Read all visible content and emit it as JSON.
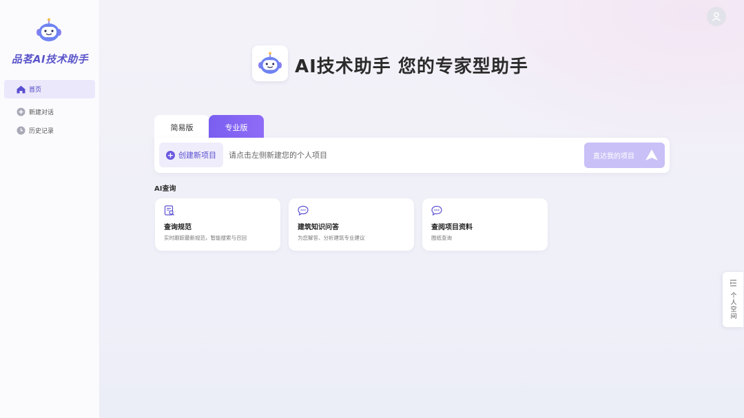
{
  "brand": {
    "title": "品茗AI技术助手"
  },
  "nav": {
    "items": [
      {
        "label": "首页",
        "icon": "home-icon",
        "active": true
      },
      {
        "label": "新建对话",
        "icon": "plus-circle-icon",
        "active": false
      },
      {
        "label": "历史记录",
        "icon": "clock-icon",
        "active": false
      }
    ]
  },
  "hero": {
    "title": "AI技术助手 您的专家型助手"
  },
  "tabs": {
    "simple": "简易版",
    "pro": "专业版"
  },
  "project_bar": {
    "create_label": "创建新项目",
    "placeholder": "请点击左侧新建您的个人项目",
    "value": "",
    "goto_label": "直达我的项目"
  },
  "section": {
    "title": "AI查询"
  },
  "cards": [
    {
      "title": "查询规范",
      "desc": "实时跟踪最新规范，智能搜索与召回",
      "icon": "document-search-icon"
    },
    {
      "title": "建筑知识问答",
      "desc": "为您解答、分析建筑专业建议",
      "icon": "chat-bubble-icon"
    },
    {
      "title": "查阅项目资料",
      "desc": "图纸查询",
      "icon": "chat-bubble-icon"
    }
  ],
  "side_tab": {
    "label": "个人空间"
  },
  "colors": {
    "accent": "#7a5ff0",
    "accent_light": "#c9c0f7",
    "brand_text": "#5b55c9"
  }
}
